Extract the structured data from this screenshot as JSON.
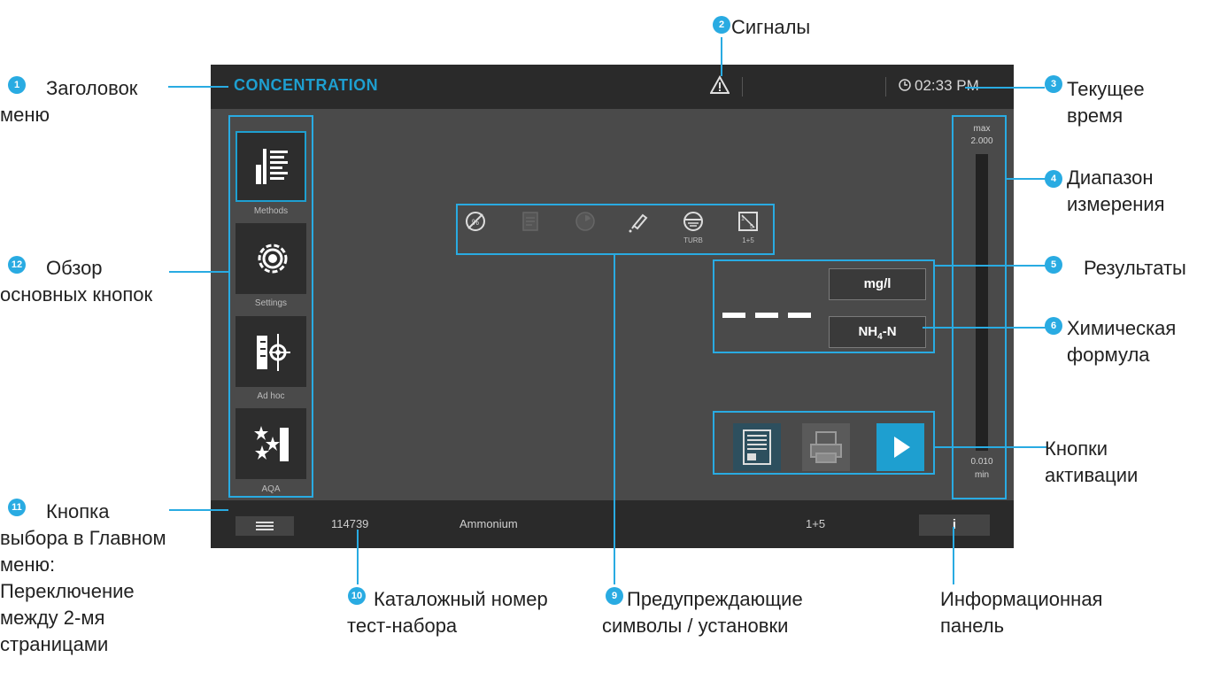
{
  "screen": {
    "menu_title": "CONCENTRATION",
    "clock": "02:33 PM",
    "sidebar": [
      {
        "label": "Methods",
        "icon": "methods-icon",
        "selected": true
      },
      {
        "label": "Settings",
        "icon": "settings-gear-icon",
        "selected": false
      },
      {
        "label": "Ad hoc",
        "icon": "ad-hoc-icon",
        "selected": false
      },
      {
        "label": "AQA",
        "icon": "aqa-stars-icon",
        "selected": false
      }
    ],
    "settings_icons": [
      {
        "icon": "no-blank-icon",
        "label": ""
      },
      {
        "icon": "document-icon",
        "label": ""
      },
      {
        "icon": "timer-icon",
        "label": ""
      },
      {
        "icon": "pipette-icon",
        "label": ""
      },
      {
        "icon": "turbidity-icon",
        "label": "TURB"
      },
      {
        "icon": "dilution-icon",
        "label": "1+5"
      }
    ],
    "result_value": "---",
    "unit": "mg/l",
    "formula_main": "NH",
    "formula_sub": "4",
    "formula_tail": "-N",
    "range": {
      "max_label": "max",
      "max_value": "2.000",
      "min_value": "0.010",
      "min_label": "min"
    },
    "bottom": {
      "catalog_number": "114739",
      "method_name": "Ammonium",
      "dilution": "1+5",
      "info_button": "i"
    }
  },
  "annotations": {
    "a1": {
      "num": "1",
      "text": "Заголовок меню"
    },
    "a2": {
      "num": "2",
      "text": "Сигналы"
    },
    "a3": {
      "num": "3",
      "text": "Текущее время"
    },
    "a4": {
      "num": "4",
      "text": "Диапазон измерения"
    },
    "a5": {
      "num": "5",
      "text": "Результаты"
    },
    "a6": {
      "num": "6",
      "text": "Химическая формула"
    },
    "a7": {
      "text": "Кнопки активации"
    },
    "a8": {
      "text": "Информационная панель"
    },
    "a9": {
      "num": "9",
      "text": "Предупреждающие символы / установки"
    },
    "a10": {
      "num": "10",
      "text": "Каталожный номер тест-набора"
    },
    "a11": {
      "num": "11",
      "text": "Кнопка выбора в Главном меню: Переключение между 2-мя страницами"
    },
    "a12": {
      "num": "12",
      "text": "Обзор основных кнопок"
    }
  },
  "colors": {
    "accent": "#29abe2",
    "title": "#1e9fd0",
    "screen_bg": "#4a4a4a",
    "bar_bg": "#2a2a2a"
  }
}
